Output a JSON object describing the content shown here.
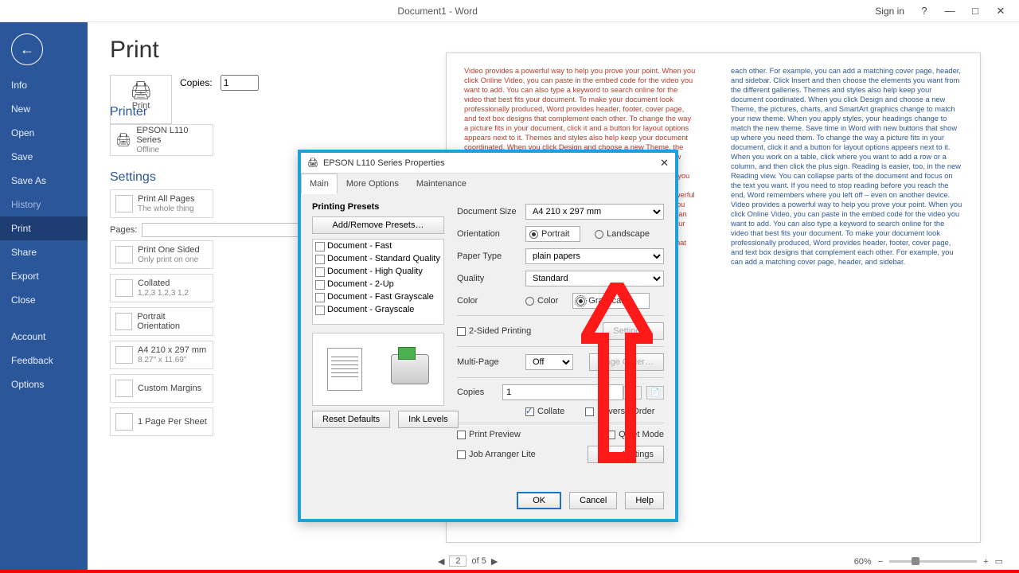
{
  "titlebar": {
    "title": "Document1 - Word",
    "signin": "Sign in"
  },
  "nav": {
    "info": "Info",
    "new": "New",
    "open": "Open",
    "save": "Save",
    "saveas": "Save As",
    "history": "History",
    "print": "Print",
    "share": "Share",
    "export": "Export",
    "close": "Close",
    "account": "Account",
    "feedback": "Feedback",
    "options": "Options"
  },
  "page": {
    "heading": "Print",
    "printLabel": "Print",
    "copiesLabel": "Copies:",
    "copies": "1",
    "printerHeading": "Printer",
    "printerName": "EPSON L110 Series",
    "printerStatus": "Offline",
    "settingsHeading": "Settings",
    "allPages": "Print All Pages",
    "allPagesSub": "The whole thing",
    "pagesLabel": "Pages:",
    "oneSided": "Print One Sided",
    "oneSidedSub": "Only print on one",
    "collated": "Collated",
    "collatedSub": "1,2,3   1,2,3   1,2",
    "orient": "Portrait Orientation",
    "paper": "A4 210 x 297 mm",
    "paperSub": "8.27\" x 11.69\"",
    "margins": "Custom Margins",
    "pps": "1 Page Per Sheet"
  },
  "pager": {
    "page": "2",
    "of": "of 5"
  },
  "zoom": {
    "pct": "60%"
  },
  "modal": {
    "title": "EPSON L110 Series Properties",
    "tabs": {
      "main": "Main",
      "more": "More Options",
      "maint": "Maintenance"
    },
    "presetsHeading": "Printing Presets",
    "addRemove": "Add/Remove Presets…",
    "presets": [
      "Document - Fast",
      "Document - Standard Quality",
      "Document - High Quality",
      "Document - 2-Up",
      "Document - Fast Grayscale",
      "Document - Grayscale"
    ],
    "docSize": "Document Size",
    "docSizeVal": "A4 210 x 297 mm",
    "orientation": "Orientation",
    "portrait": "Portrait",
    "landscape": "Landscape",
    "paperType": "Paper Type",
    "paperTypeVal": "plain papers",
    "quality": "Quality",
    "qualityVal": "Standard",
    "color": "Color",
    "colorOpt": "Color",
    "grayscale": "Grayscale",
    "twoSided": "2-Sided Printing",
    "settingsBtn": "Settings…",
    "multiPage": "Multi-Page",
    "multiPageVal": "Off",
    "pageOrder": "Page Order…",
    "copies": "Copies",
    "copiesVal": "1",
    "collate": "Collate",
    "reverse": "Reverse Order",
    "printPreview": "Print Preview",
    "jobArranger": "Job Arranger Lite",
    "quietMode": "Quiet Mode",
    "showSettings": "Show Settings",
    "resetDefaults": "Reset Defaults",
    "inkLevels": "Ink Levels",
    "ok": "OK",
    "cancel": "Cancel",
    "help": "Help"
  },
  "previewText": {
    "left": "Video provides a powerful way to help you prove your point. When you click Online Video, you can paste in the embed code for the video you want to add. You can also type a keyword to search online for the video that best fits your document. To make your document look professionally produced, Word provides header, footer, cover page, and text box designs that complement each other. To change the way a picture fits in your document, click it and a button for layout options appears next to it. Themes and styles also help keep your document coordinated. When you click Design and choose a new Theme, the pictures, charts, and SmartArt graphics change to match your new theme. Reading is easier, too, in the new Reading view. You can collapse parts of the document and focus on the text you want. If you need to stop reading before you reach the end, Word remembers where you left off – even on another device. Video provides a powerful way to help you prove your point. When you click Online Video, you can paste in the embed code for the video you want to add. You can also type a keyword to search online for the video that best fits your document. To make your document look professionally produced, Word provides header, footer, cover page, and text box designs that complement each other.",
    "right": "each other. For example, you can add a matching cover page, header, and sidebar. Click Insert and then choose the elements you want from the different galleries. Themes and styles also help keep your document coordinated. When you click Design and choose a new Theme, the pictures, charts, and SmartArt graphics change to match your new theme. When you apply styles, your headings change to match the new theme. Save time in Word with new buttons that show up where you need them.\nTo change the way a picture fits in your document, click it and a button for layout options appears next to it. When you work on a table, click where you want to add a row or a column, and then click the plus sign. Reading is easier, too, in the new Reading view. You can collapse parts of the document and focus on the text you want. If you need to stop reading before you reach the end, Word remembers where you left off – even on another device. Video provides a powerful way to help you prove your point. When you click Online Video, you can paste in the embed code for the video you want to add. You can also type a keyword to search online for the video that best fits your document. To make your document look professionally produced, Word provides header, footer, cover page, and text box designs that complement each other. For example, you can add a matching cover page, header, and sidebar."
  }
}
